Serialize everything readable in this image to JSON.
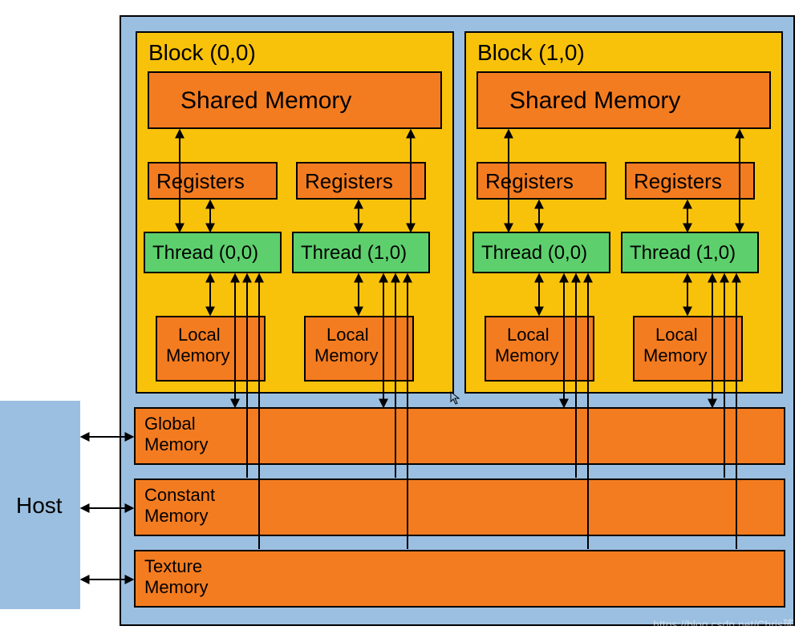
{
  "host": {
    "label": "Host"
  },
  "blocks": [
    {
      "title": "Block (0,0)",
      "shared": "Shared Memory",
      "threads": [
        {
          "registers": "Registers",
          "thread": "Thread (0,0)",
          "local": "Local Memory"
        },
        {
          "registers": "Registers",
          "thread": "Thread (1,0)",
          "local": "Local Memory"
        }
      ]
    },
    {
      "title": "Block (1,0)",
      "shared": "Shared Memory",
      "threads": [
        {
          "registers": "Registers",
          "thread": "Thread (0,0)",
          "local": "Local Memory"
        },
        {
          "registers": "Registers",
          "thread": "Thread (1,0)",
          "local": "Local Memory"
        }
      ]
    }
  ],
  "memories": {
    "global": "Global Memory",
    "constant": "Constant Memory",
    "texture": "Texture Memory"
  },
  "watermark": "https://blog.csdn.net/Chris瑤"
}
